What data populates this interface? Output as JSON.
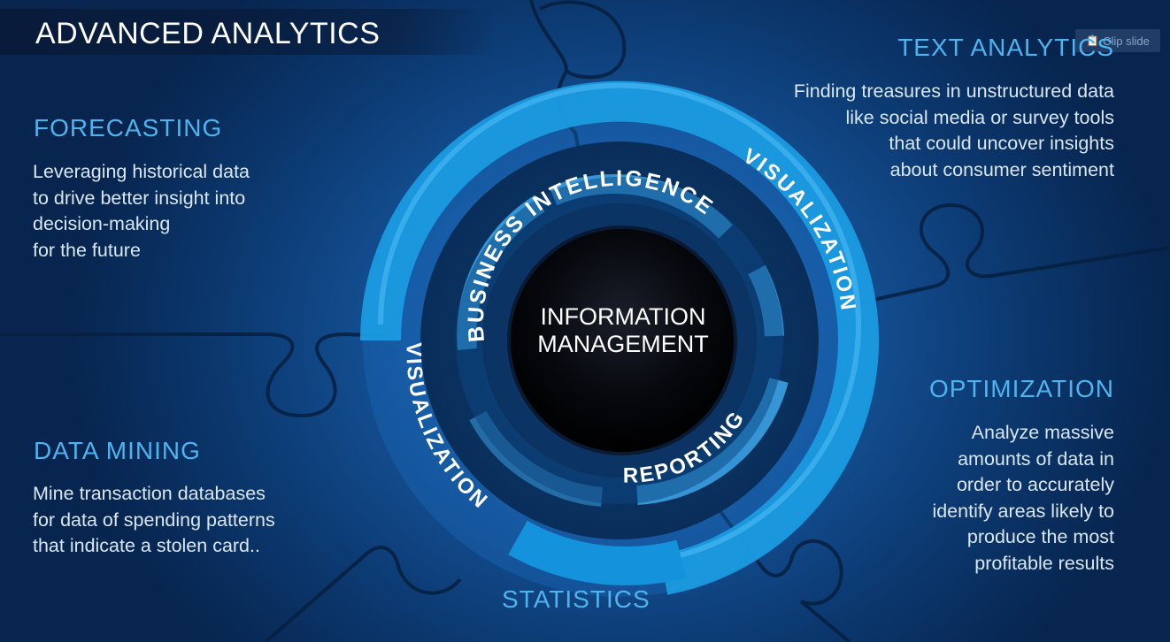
{
  "title": "ADVANCED ANALYTICS",
  "clip_button": {
    "label": "Clip slide",
    "icon": "clipboard-icon"
  },
  "sections": {
    "forecasting": {
      "heading": "FORECASTING",
      "lines": [
        "Leveraging historical data",
        "to drive better insight into",
        "decision-making",
        "for the future"
      ]
    },
    "text_analytics": {
      "heading": "TEXT ANALYTICS",
      "lines": [
        "Finding treasures in unstructured data",
        "like social media or survey tools",
        "that could uncover insights",
        "about consumer sentiment"
      ]
    },
    "data_mining": {
      "heading": "DATA MINING",
      "lines": [
        "Mine transaction databases",
        "for data of spending patterns",
        "that indicate a stolen card.."
      ]
    },
    "optimization": {
      "heading": "OPTIMIZATION",
      "lines": [
        "Analyze massive",
        "amounts of data in",
        "order to accurately",
        "identify areas likely to",
        "produce the most",
        "profitable results"
      ]
    },
    "statistics": {
      "heading": "STATISTICS"
    }
  },
  "wheel": {
    "center_lines": [
      "INFORMATION",
      "MANAGEMENT"
    ],
    "inner_top": "BUSINESS INTELLIGENCE",
    "inner_bottom": "REPORTING",
    "outer_right": "VISUALIZATION",
    "outer_left": "VISUALIZATION"
  },
  "colors": {
    "accent": "#4fb3ee",
    "ring": "#1a9be0",
    "background": "#15549a",
    "center": "#05070c"
  }
}
